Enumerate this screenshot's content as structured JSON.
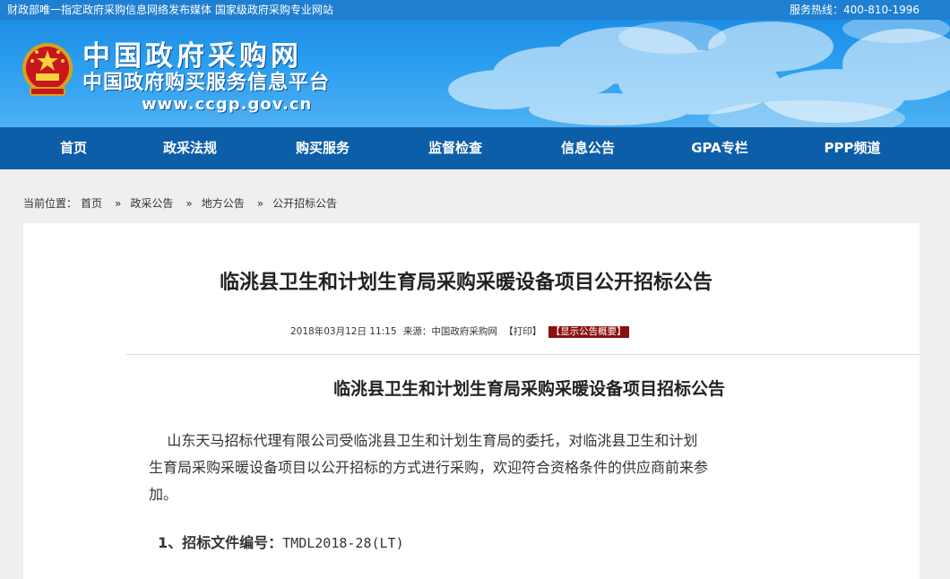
{
  "topbar": {
    "left_text": "财政部唯一指定政府采购信息网络发布媒体  国家级政府采购专业网站",
    "hotline": "服务热线：400-810-1996"
  },
  "header": {
    "title": "中国政府采购网",
    "subtitle": "中国政府购买服务信息平台",
    "url": "www.ccgp.gov.cn"
  },
  "nav": {
    "items": [
      {
        "label": "首页"
      },
      {
        "label": "政采法规"
      },
      {
        "label": "购买服务"
      },
      {
        "label": "监督检查"
      },
      {
        "label": "信息公告"
      },
      {
        "label": "GPA专栏"
      },
      {
        "label": "PPP频道"
      }
    ]
  },
  "breadcrumb": {
    "prefix": "当前位置：",
    "items": [
      "首页",
      "政采公告",
      "地方公告",
      "公开招标公告"
    ],
    "separator": "»"
  },
  "article": {
    "title": "临洮县卫生和计划生育局采购采暖设备项目公开招标公告",
    "date": "2018年03月12日  11:15",
    "source": "来源：中国政府采购网",
    "print": "【打印】",
    "summary_button": "【显示公告概要】",
    "doc_heading": "临洮县卫生和计划生育局采购采暖设备项目招标公告",
    "paragraph_lines": [
      "    山东天马招标代理有限公司受临洮县卫生和计划生育局的委托，对临洮县卫生和计划",
      "生育局采购采暖设备项目以公开招标的方式进行采购，欢迎符合资格条件的供应商前来参",
      "加。"
    ],
    "item1_label": "1、招标文件编号：",
    "item1_value": "TMDL2018-28(LT)"
  },
  "colors": {
    "topbar": "#1f7fd0",
    "banner": "#2c9ff0",
    "nav": "#0d5ea8",
    "summary_button": "#8b1010",
    "page_bg": "#efefef"
  }
}
